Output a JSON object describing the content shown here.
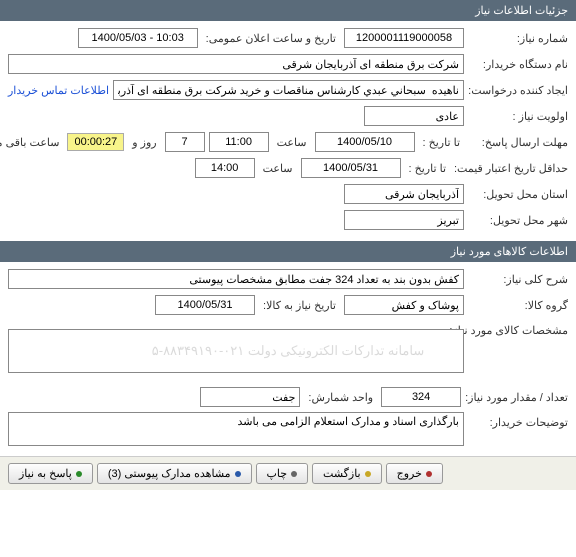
{
  "sections": {
    "need_info_title": "جزئیات اطلاعات نیاز",
    "items_info_title": "اطلاعات کالاهای مورد نیاز"
  },
  "need": {
    "number_label": "شماره نیاز:",
    "number": "1200001119000058",
    "announce_label": "تاریخ و ساعت اعلان عمومی:",
    "announce": "1400/05/03 - 10:03",
    "buyer_label": "نام دستگاه خریدار:",
    "buyer": "شرکت برق منطقه ای آذربایجان شرقی",
    "creator_label": "ایجاد کننده درخواست:",
    "creator": "ناهیده  سبحاني عبدي کارشناس مناقصات و خرید شرکت برق منطقه ای آذربایجا",
    "contact_link": "اطلاعات تماس خریدار",
    "priority_label": "اولویت نیاز :",
    "priority": "عادی",
    "deadline_label": "مهلت ارسال پاسخ:",
    "to_date_label": "تا تاریخ :",
    "deadline_date": "1400/05/10",
    "time_label": "ساعت",
    "deadline_time": "11:00",
    "days": "7",
    "days_label": "روز و",
    "countdown": "00:00:27",
    "remaining_label": "ساعت باقی مانده",
    "validity_label": "حداقل تاریخ اعتبار قیمت:",
    "validity_date": "1400/05/31",
    "validity_time": "14:00",
    "deliver_prov_label": "استان محل تحویل:",
    "deliver_prov": "آذربایجان شرقی",
    "deliver_city_label": "شهر محل تحویل:",
    "deliver_city": "تبریز"
  },
  "items": {
    "summary_label": "شرح کلی نیاز:",
    "summary": "کفش بدون بند به تعداد 324 جفت مطابق مشخصات پیوستی",
    "group_label": "گروه کالا:",
    "group": "پوشاک و کفش",
    "need_date_label": "تاریخ نیاز به کالا:",
    "need_date": "1400/05/31",
    "spec_label": "مشخصات کالای مورد نیاز:",
    "spec": "",
    "watermark": "سامانه تدارکات الکترونیکی دولت\n۰۲۱-۸۸۳۴۹۱۹۰-۵",
    "qty_label": "تعداد / مقدار مورد نیاز:",
    "qty": "324",
    "unit_label": "واحد شمارش:",
    "unit": "جفت",
    "buyer_notes_label": "توضیحات خریدار:",
    "buyer_notes": "بارگذاری اسناد و مدارک استعلام الزامی می باشد"
  },
  "footer": {
    "respond": "پاسخ به نیاز",
    "attachments": "مشاهده مدارک پیوستی (3)",
    "print": "چاپ",
    "back": "بازگشت",
    "exit": "خروج"
  }
}
